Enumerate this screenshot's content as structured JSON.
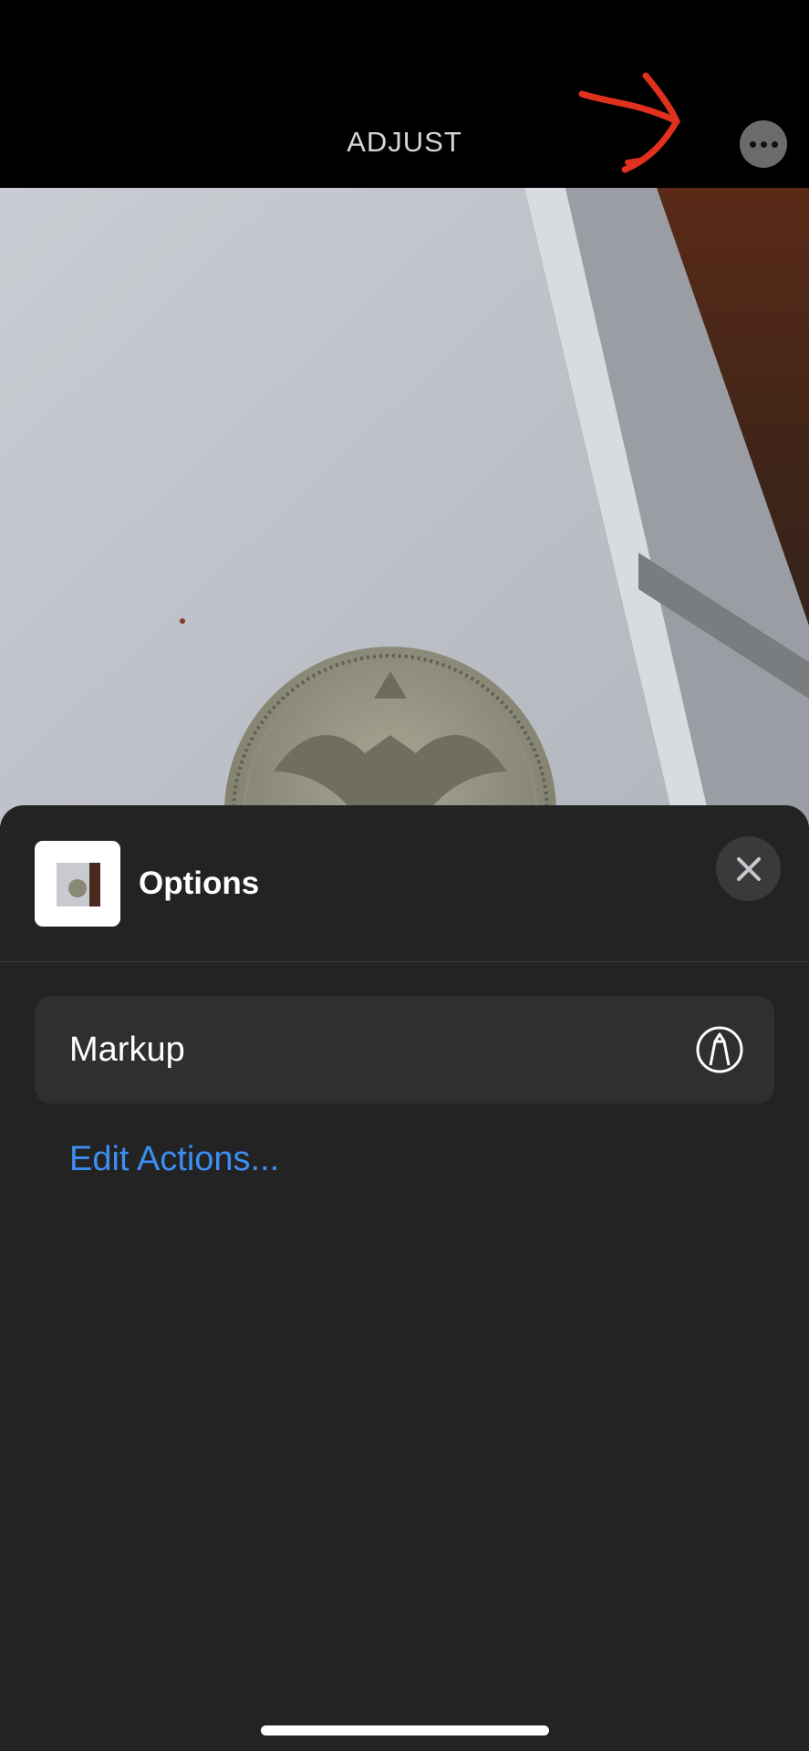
{
  "topbar": {
    "title": "ADJUST",
    "more_icon": "ellipsis-circle-icon"
  },
  "annotation": {
    "color": "#e0301e",
    "icon": "hand-drawn-arrow"
  },
  "sheet": {
    "title": "Options",
    "close_icon": "close-icon",
    "actions": [
      {
        "label": "Markup",
        "icon": "markup-pen-icon"
      }
    ],
    "edit_link": "Edit Actions...",
    "link_color": "#3d8ef2"
  }
}
